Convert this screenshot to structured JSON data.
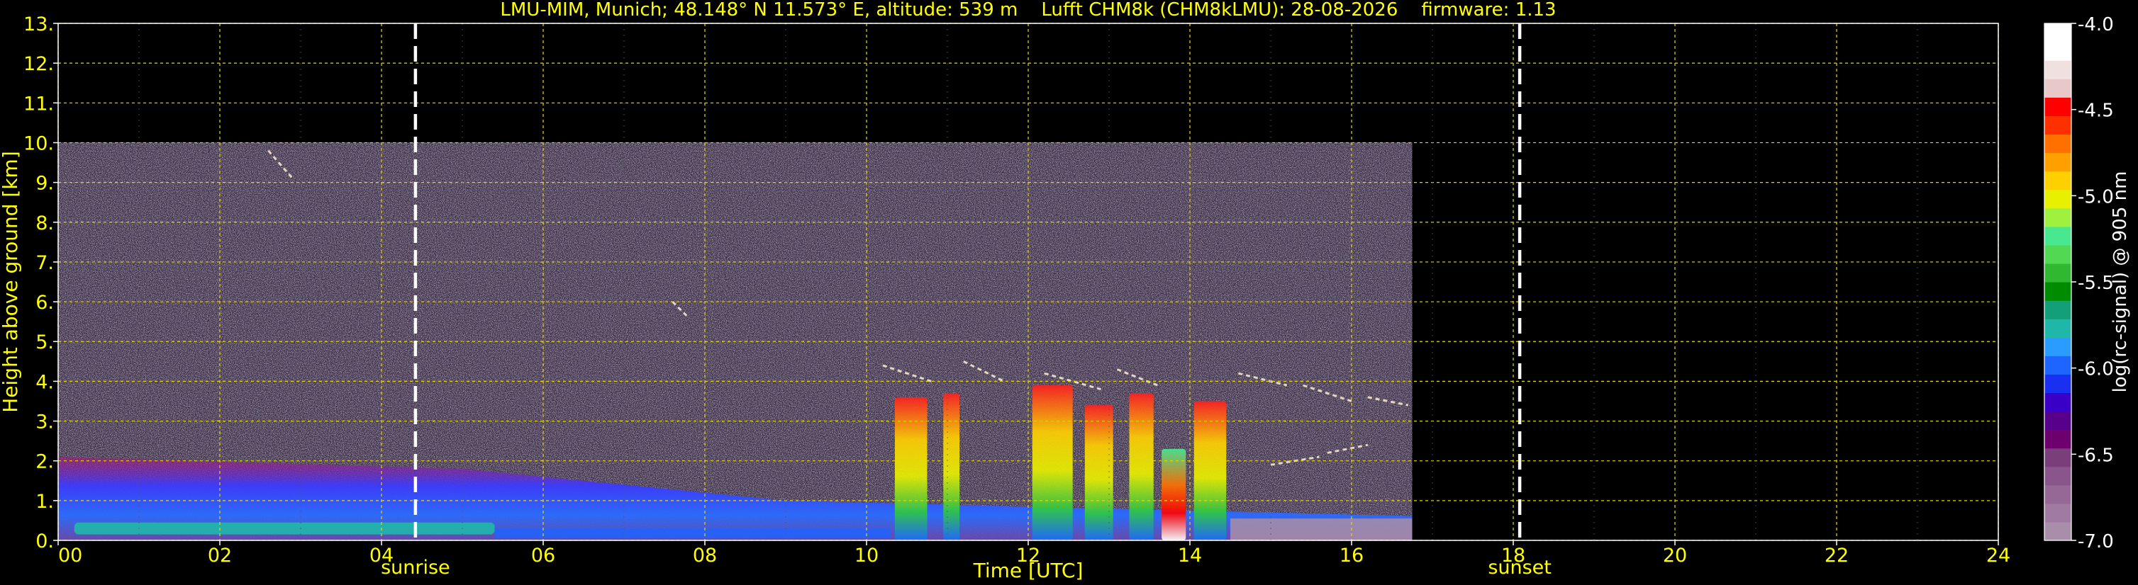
{
  "chart_data": {
    "type": "heatmap",
    "title": "LMU-MIM, Munich; 48.148° N 11.573° E, altitude: 539 m    Lufft CHM8k (CHM8kLMU): 28-08-2026    firmware: 1.13",
    "xlabel": "Time [UTC]",
    "ylabel": "Height above ground [km]",
    "xlim": [
      0,
      24
    ],
    "ylim": [
      0,
      13
    ],
    "x_ticks": [
      "00",
      "02",
      "04",
      "06",
      "08",
      "10",
      "12",
      "14",
      "16",
      "18",
      "20",
      "22",
      "24"
    ],
    "y_ticks": [
      "0.",
      "1.",
      "2.",
      "3.",
      "4.",
      "5.",
      "6.",
      "7.",
      "8.",
      "9.",
      "10.",
      "11.",
      "12.",
      "13."
    ],
    "grid": true,
    "data_extent": {
      "time_end": 16.75,
      "height_max": 10
    },
    "events": [
      {
        "label": "sunrise",
        "time": 4.42
      },
      {
        "label": "sunset",
        "time": 18.08
      }
    ],
    "colorbar": {
      "label": "log(rc-signal) @ 905 nm",
      "range": [
        -7.0,
        -4.0
      ],
      "ticks": [
        "-4.0",
        "-4.5",
        "-5.0",
        "-5.5",
        "-6.0",
        "-6.5",
        "-7.0"
      ],
      "colors": [
        "#a88ea8",
        "#a07aa0",
        "#966896",
        "#8a558a",
        "#7a3f7a",
        "#6e006e",
        "#56008c",
        "#3a00c8",
        "#1a30f0",
        "#1e64ff",
        "#2a9cff",
        "#1fb8a8",
        "#13a078",
        "#008c00",
        "#30b830",
        "#52d852",
        "#48e890",
        "#a0f040",
        "#e8f000",
        "#ffd000",
        "#ffa000",
        "#ff7000",
        "#ff3000",
        "#ff0000",
        "#e8c8c8",
        "#f0e0e0",
        "#ffffff",
        "#ffffff"
      ]
    },
    "features": [
      {
        "label": "boundary layer aerosol",
        "time": [
          0,
          16.75
        ],
        "height": [
          0,
          2.1
        ]
      },
      {
        "label": "cloud columns",
        "time": [
          10.3,
          14.5
        ],
        "height": [
          0,
          4.6
        ]
      },
      {
        "label": "mid-level cloud fragments",
        "time": [
          12,
          16.75
        ],
        "height": [
          1.5,
          4.8
        ]
      }
    ]
  }
}
